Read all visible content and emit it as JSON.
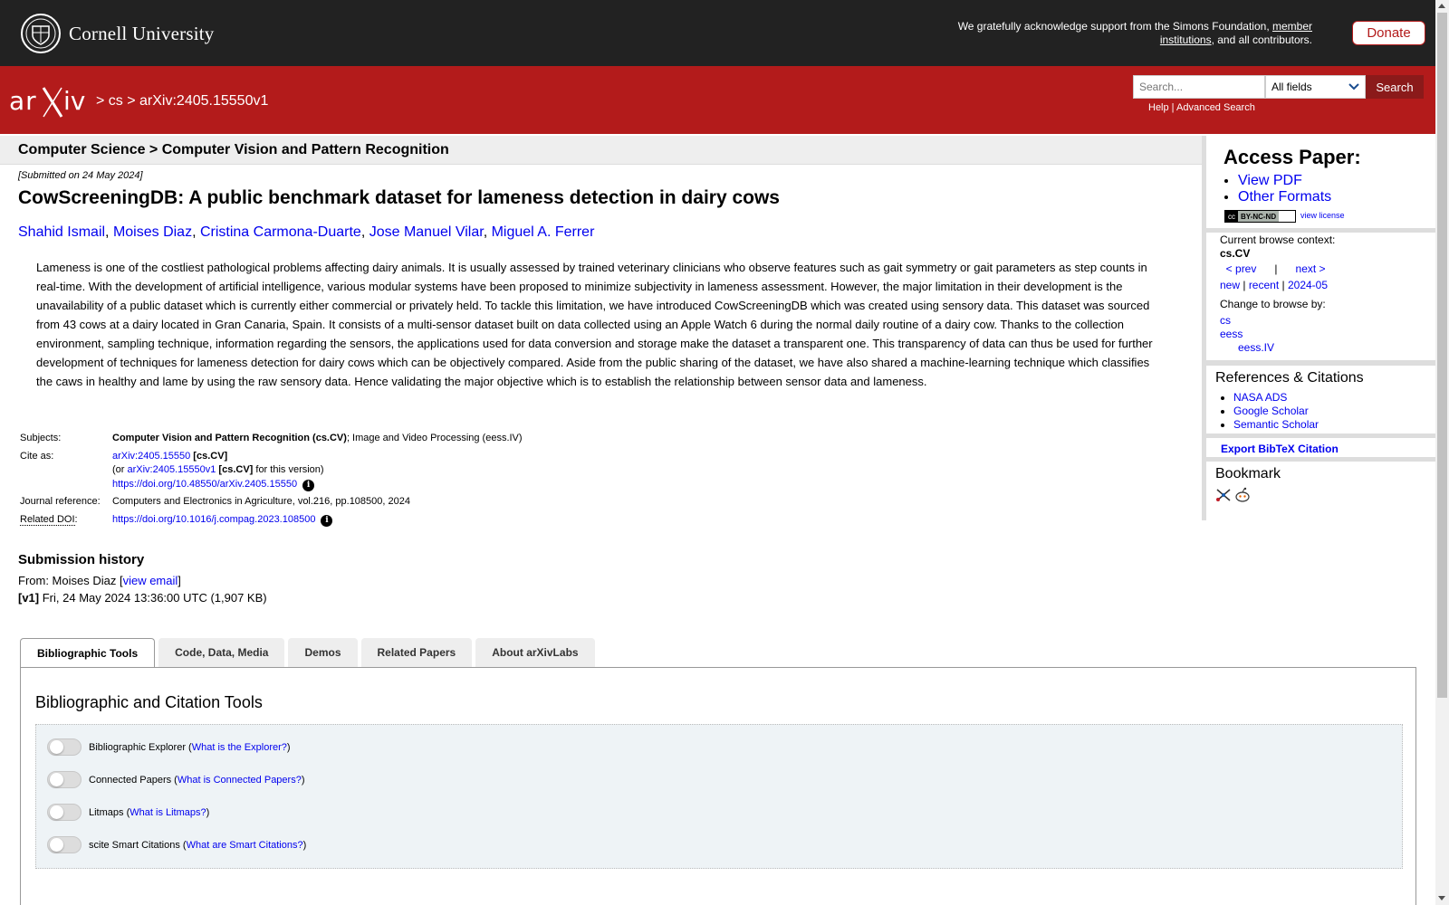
{
  "topbar": {
    "org_name": "Cornell University",
    "support_text": "We gratefully acknowledge support from the Simons Foundation, ",
    "support_link": "member institutions",
    "support_tail": ", and all contributors.",
    "donate_label": "Donate"
  },
  "header": {
    "breadcrumb_sep1": " > ",
    "breadcrumb_cs": "cs",
    "breadcrumb_sep2": " > ",
    "breadcrumb_id": "arXiv:2405.15550v1",
    "search_placeholder": "Search...",
    "field_select": "All fields",
    "search_button": "Search",
    "help_link": "Help",
    "links_sep": " | ",
    "advanced_link": "Advanced Search"
  },
  "category_strip": "Computer Science > Computer Vision and Pattern Recognition",
  "paper": {
    "submitted": "[Submitted on 24 May 2024]",
    "title": "CowScreeningDB: A public benchmark dataset for lameness detection in dairy cows",
    "authors": [
      "Shahid Ismail",
      "Moises Diaz",
      "Cristina Carmona-Duarte",
      "Jose Manuel Vilar",
      "Miguel A. Ferrer"
    ],
    "abstract": "Lameness is one of the costliest pathological problems affecting dairy animals. It is usually assessed by trained veterinary clinicians who observe features such as gait symmetry or gait parameters as step counts in real-time. With the development of artificial intelligence, various modular systems have been proposed to minimize subjectivity in lameness assessment. However, the major limitation in their development is the unavailability of a public dataset which is currently either commercial or privately held. To tackle this limitation, we have introduced CowScreeningDB which was created using sensory data. This dataset was sourced from 43 cows at a dairy located in Gran Canaria, Spain. It consists of a multi-sensor dataset built on data collected using an Apple Watch 6 during the normal daily routine of a dairy cow. Thanks to the collection environment, sampling technique, information regarding the sensors, the applications used for data conversion and storage make the dataset a transparent one. This transparency of data can thus be used for further development of techniques for lameness detection for dairy cows which can be objectively compared. Aside from the public sharing of the dataset, we have also shared a machine-learning technique which classifies the caws in healthy and lame by using the raw sensory data. Hence validating the major objective which is to establish the relationship between sensor data and lameness."
  },
  "meta": {
    "subjects_label": "Subjects:",
    "subjects_primary": "Computer Vision and Pattern Recognition (cs.CV)",
    "subjects_rest": "; Image and Video Processing (eess.IV)",
    "cite_label": "Cite as:",
    "cite_id": "arXiv:2405.15550",
    "cite_cat": " [cs.CV]",
    "cite_or": "(or ",
    "cite_version_id": "arXiv:2405.15550v1",
    "cite_version_cat": " [cs.CV]",
    "cite_version_tail": " for this version)",
    "cite_doi": "https://doi.org/10.48550/arXiv.2405.15550",
    "journal_label": "Journal reference:",
    "journal_value": "Computers and Electronics in Agriculture, vol.216, pp.108500, 2024",
    "related_doi_abbr": "Related DOI",
    "related_doi_colon": ":",
    "related_doi_value": "https://doi.org/10.1016/j.compag.2023.108500"
  },
  "submission": {
    "title": "Submission history",
    "from_text": "From: Moises Diaz [",
    "view_email": "view email",
    "from_close": "]",
    "v1_label": "[v1]",
    "v1_text": " Fri, 24 May 2024 13:36:00 UTC (1,907 KB)"
  },
  "tabs": [
    {
      "label": "Bibliographic Tools",
      "active": true
    },
    {
      "label": "Code, Data, Media",
      "active": false
    },
    {
      "label": "Demos",
      "active": false
    },
    {
      "label": "Related Papers",
      "active": false
    },
    {
      "label": "About arXivLabs",
      "active": false
    }
  ],
  "tools": {
    "title": "Bibliographic and Citation Tools",
    "rows": [
      {
        "name": "Bibliographic Explorer",
        "link": "What is the Explorer?"
      },
      {
        "name": "Connected Papers",
        "link": "What is Connected Papers?"
      },
      {
        "name": "Litmaps",
        "link": "What is Litmaps?"
      },
      {
        "name": "scite Smart Citations",
        "link": "What are Smart Citations?"
      }
    ]
  },
  "sidebar": {
    "access_title": "Access Paper:",
    "access_links": [
      "View PDF",
      "Other Formats"
    ],
    "cc_text": "cc",
    "cc_label": "BY-NC-ND",
    "view_license": "view license",
    "browse_label": "Current browse context:",
    "browse_ctx": "cs.CV",
    "prev": "< prev",
    "pipe": "|",
    "next": "next >",
    "new": "new",
    "recent": "recent",
    "date": "2024-05",
    "change_label": "Change to browse by:",
    "cat_cs": "cs",
    "cat_eess": "eess",
    "cat_eess_iv": "eess.IV",
    "refs_title": "References & Citations",
    "refs_links": [
      "NASA ADS",
      "Google Scholar",
      "Semantic Scholar"
    ],
    "bibtex": "Export BibTeX Citation",
    "bookmark_title": "Bookmark"
  },
  "colors": {
    "arxiv_red": "#b31b1b",
    "topbar": "#222222",
    "link": "#0000ee"
  }
}
